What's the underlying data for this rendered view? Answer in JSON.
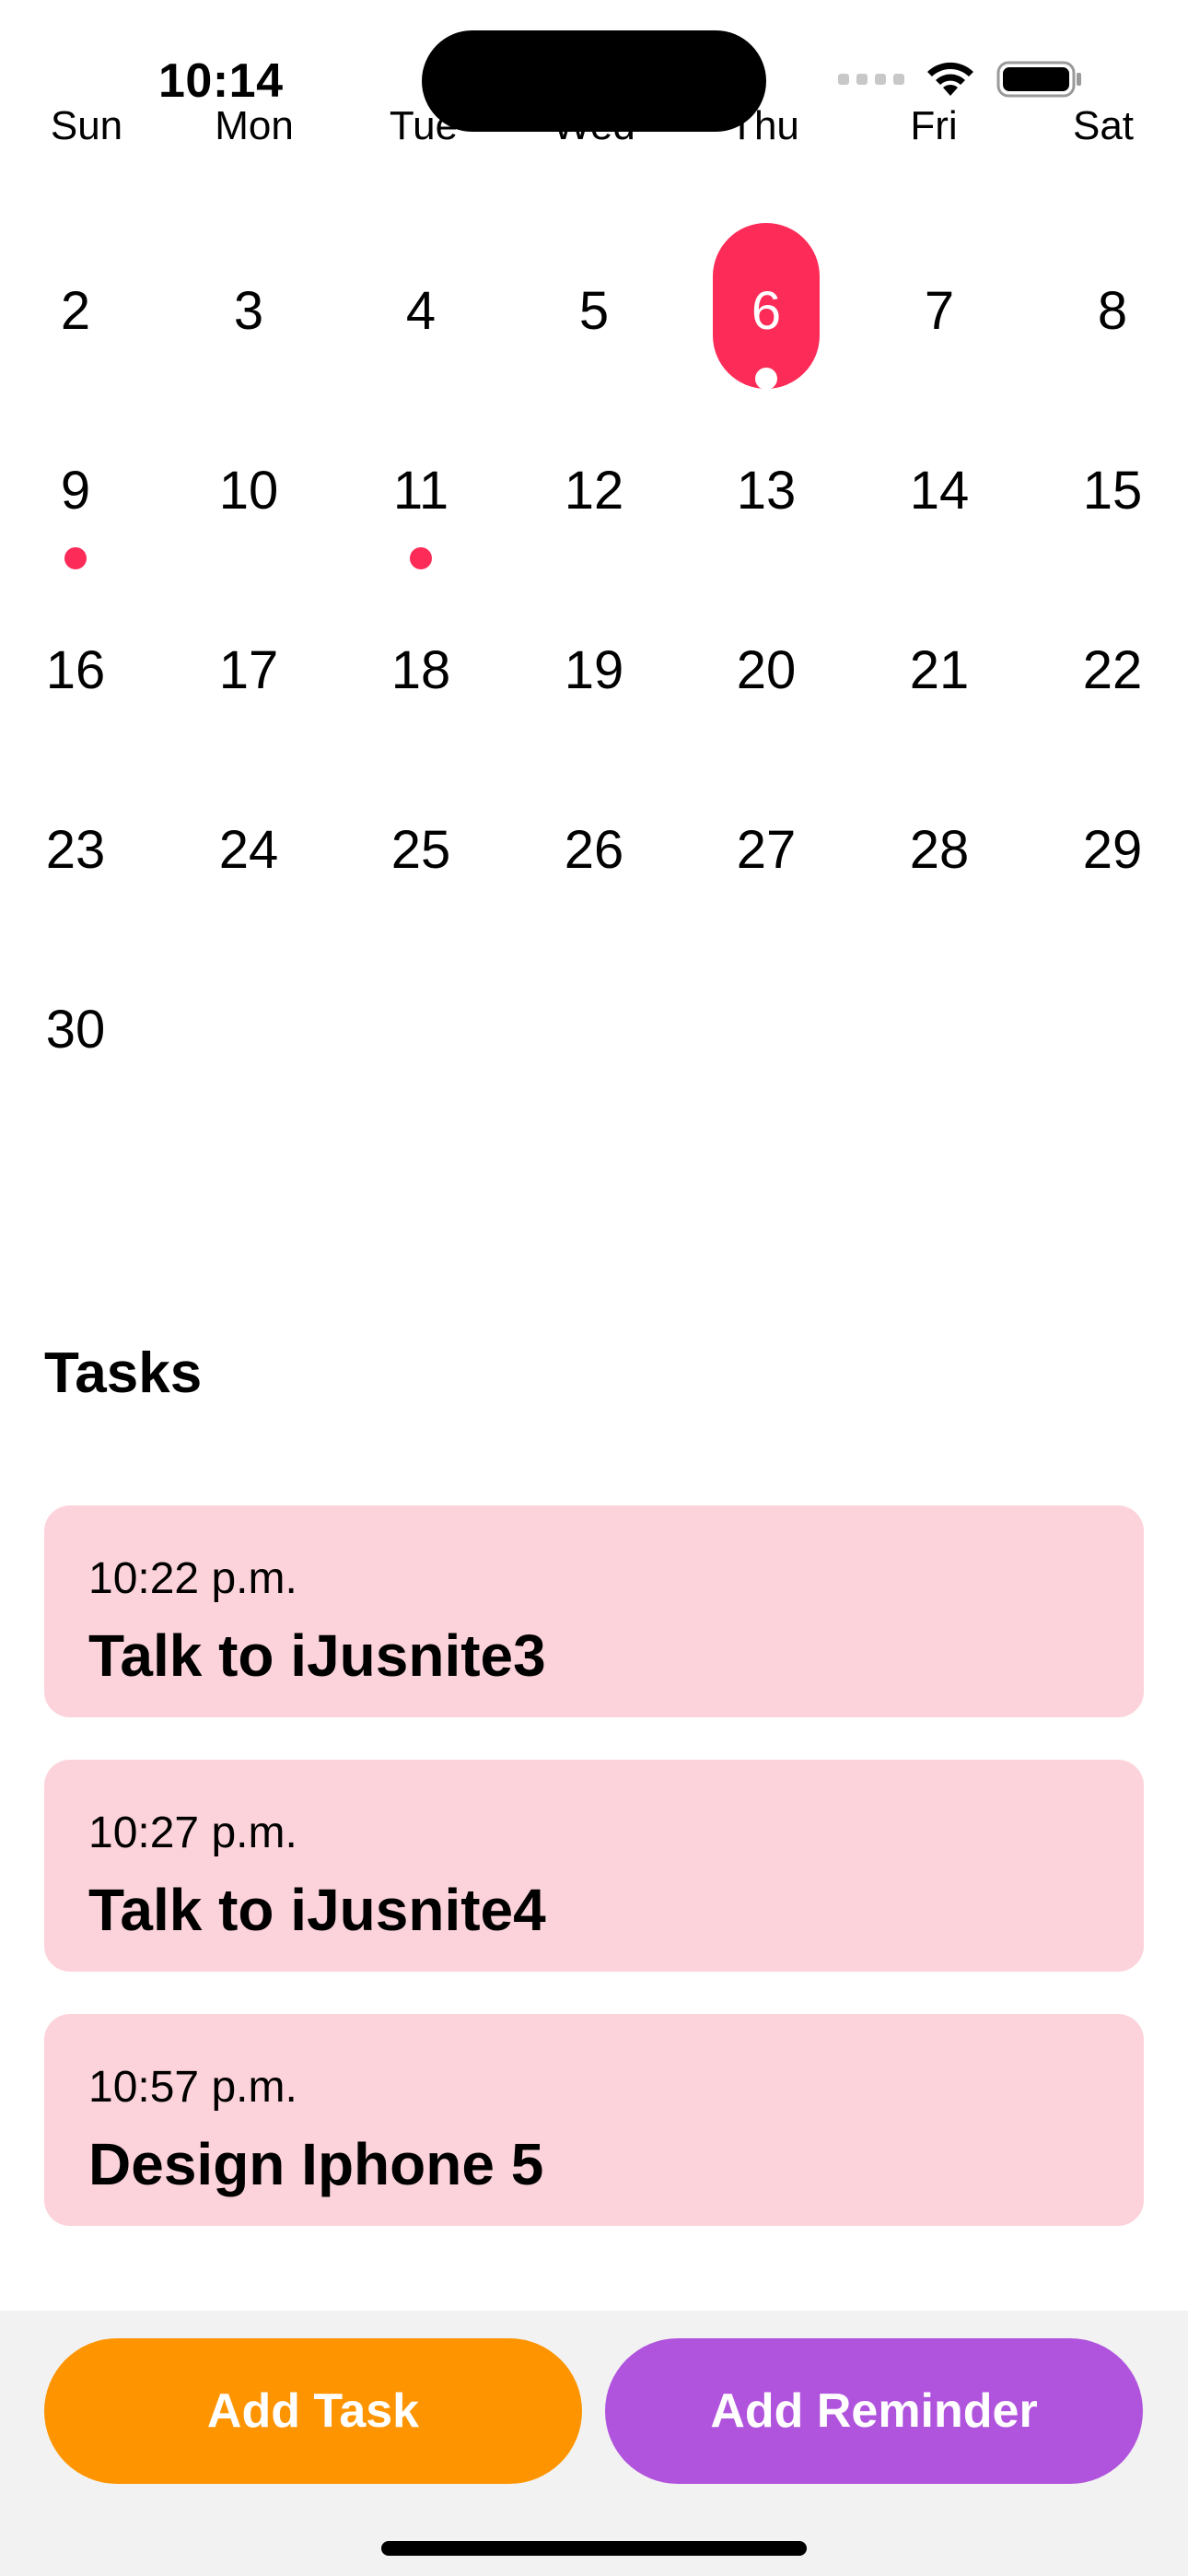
{
  "status_bar": {
    "time": "10:14"
  },
  "calendar": {
    "weekdays": [
      "Sun",
      "Mon",
      "Tue",
      "Wed",
      "Thu",
      "Fri",
      "Sat"
    ],
    "weeks": [
      [
        "2",
        "3",
        "4",
        "5",
        "6",
        "7",
        "8"
      ],
      [
        "9",
        "10",
        "11",
        "12",
        "13",
        "14",
        "15"
      ],
      [
        "16",
        "17",
        "18",
        "19",
        "20",
        "21",
        "22"
      ],
      [
        "23",
        "24",
        "25",
        "26",
        "27",
        "28",
        "29"
      ],
      [
        "30",
        "",
        "",
        "",
        "",
        "",
        ""
      ]
    ],
    "selected_day": "6",
    "days_with_events": [
      "6",
      "9",
      "11"
    ],
    "accent_color": "#fc2b57"
  },
  "tasks": {
    "title": "Tasks",
    "items": [
      {
        "time": "10:22 p.m.",
        "title": "Talk to iJusnite3"
      },
      {
        "time": "10:27 p.m.",
        "title": "Talk to iJusnite4"
      },
      {
        "time": "10:57 p.m.",
        "title": "Design Iphone 5"
      }
    ],
    "card_color": "#fcd3da"
  },
  "actions": {
    "add_task_label": "Add Task",
    "add_task_color": "#fe9400",
    "add_reminder_label": "Add Reminder",
    "add_reminder_color": "#b053dd"
  }
}
